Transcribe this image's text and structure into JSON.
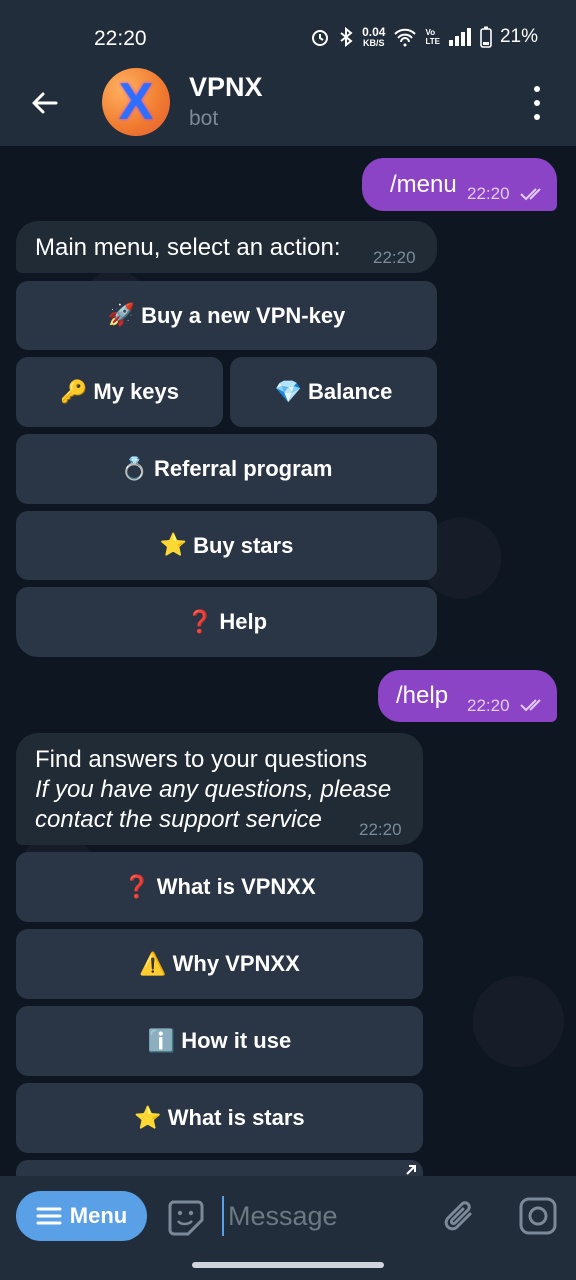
{
  "status": {
    "time": "22:20",
    "net_speed_value": "0.04",
    "net_speed_unit": "KB/S",
    "vo_top": "Vo",
    "vo_bottom": "LTE",
    "battery": "21%"
  },
  "header": {
    "avatar_letter": "X",
    "title": "VPNX",
    "subtitle": "bot"
  },
  "messages": {
    "out1": {
      "text": "/menu",
      "time": "22:20"
    },
    "in1": {
      "text": "Main menu, select an action:",
      "time": "22:20"
    },
    "keyboard1": [
      {
        "emoji": "🚀",
        "label": "Buy a new VPN-key"
      },
      {
        "emoji": "🔑",
        "label": "My keys"
      },
      {
        "emoji": "💎",
        "label": "Balance"
      },
      {
        "emoji": "💍",
        "label": "Referral program"
      },
      {
        "emoji": "⭐",
        "label": "Buy stars"
      },
      {
        "emoji": "❓",
        "label": "Help"
      }
    ],
    "out2": {
      "text": "/help",
      "time": "22:20"
    },
    "in2": {
      "line1": "Find answers to your questions",
      "line2": "If you have any questions, please",
      "line3": "contact the support service",
      "time": "22:20"
    },
    "keyboard2": [
      {
        "emoji": "❓",
        "label": "What is VPNXX"
      },
      {
        "emoji": "⚠️",
        "label": "Why VPNXX"
      },
      {
        "emoji": "ℹ️",
        "label": "How it use"
      },
      {
        "emoji": "⭐",
        "label": "What is stars"
      }
    ]
  },
  "input": {
    "menu_label": "Menu",
    "placeholder": "Message"
  },
  "colors": {
    "outgoing_bubble": "#8c44c7",
    "incoming_bubble": "#202b36",
    "menu_button": "#5aa0e6"
  }
}
